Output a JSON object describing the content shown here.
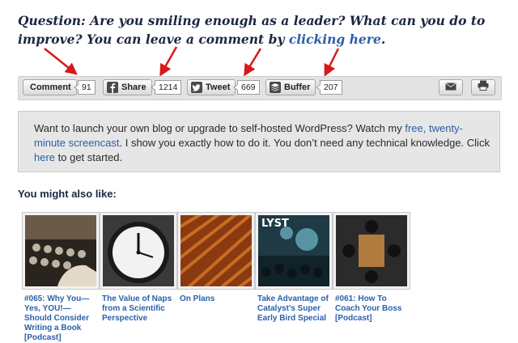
{
  "question": {
    "prefix": "Question: Are you smiling enough as a leader? What can you do to improve? You can leave a comment by ",
    "link": "clicking here",
    "suffix": "."
  },
  "share_bar": {
    "comment_label": "Comment",
    "comment_count": "91",
    "share_label": "Share",
    "share_count": "1214",
    "tweet_label": "Tweet",
    "tweet_count": "669",
    "buffer_label": "Buffer",
    "buffer_count": "207",
    "icons": [
      "facebook-icon",
      "twitter-icon",
      "buffer-icon",
      "mail-icon",
      "print-icon"
    ]
  },
  "promo": {
    "text1": "Want to launch your own blog or upgrade to self-hosted WordPress? Watch my ",
    "link1": "free, twenty-minute screencast",
    "text2": ". I show you exactly how to do it. You don’t need any technical knowledge. Click ",
    "link2": "here",
    "text3": " to get started."
  },
  "related": {
    "heading": "You might also like:",
    "items": [
      {
        "title": "#065: Why You—Yes, YOU!—Should Consider Writing a Book [Podcast]"
      },
      {
        "title": "The Value of Naps from a Scientific Perspective"
      },
      {
        "title": "On Plans"
      },
      {
        "title": "Take Advantage of Catalyst’s Super Early Bird Special"
      },
      {
        "title": "#061: How To Coach Your Boss [Podcast]"
      }
    ],
    "thumb4_text": "LYST"
  },
  "colors": {
    "question_text": "#1c2740",
    "link": "#2b5fa8",
    "arrow": "#d7191c",
    "promo_bg": "#e6e6e6",
    "bar_bg": "#e3e3e3"
  }
}
